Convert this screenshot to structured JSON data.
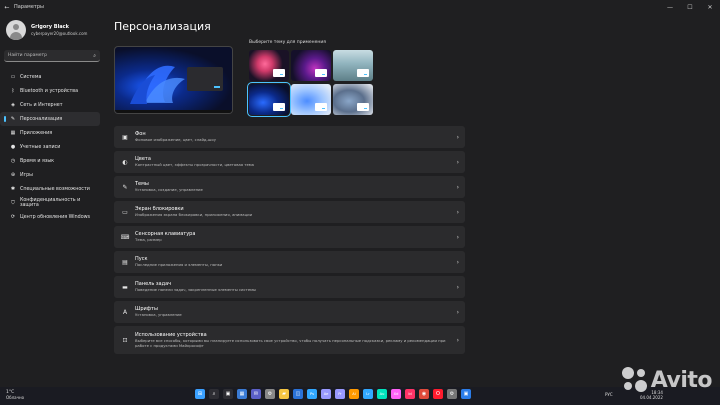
{
  "window": {
    "title": "Параметры",
    "back": "←",
    "controls": [
      "—",
      "☐",
      "✕"
    ]
  },
  "user": {
    "name": "Grigory Black",
    "email": "cyberpayer20@outlook.com"
  },
  "search": {
    "placeholder": "Найти параметр",
    "icon": "search-icon"
  },
  "nav": [
    {
      "label": "Система",
      "icon": "monitor-icon",
      "glyph": "▭"
    },
    {
      "label": "Bluetooth и устройства",
      "icon": "bluetooth-icon",
      "glyph": "ᛒ"
    },
    {
      "label": "Сеть и Интернет",
      "icon": "network-icon",
      "glyph": "◈"
    },
    {
      "label": "Персонализация",
      "icon": "brush-icon",
      "glyph": "✎",
      "active": true
    },
    {
      "label": "Приложения",
      "icon": "apps-icon",
      "glyph": "▦"
    },
    {
      "label": "Учетные записи",
      "icon": "person-icon",
      "glyph": "●"
    },
    {
      "label": "Время и язык",
      "icon": "globe-icon",
      "glyph": "◷"
    },
    {
      "label": "Игры",
      "icon": "gamepad-icon",
      "glyph": "⊕"
    },
    {
      "label": "Специальные возможности",
      "icon": "accessibility-icon",
      "glyph": "✱"
    },
    {
      "label": "Конфиденциальность и защита",
      "icon": "shield-icon",
      "glyph": "⛉"
    },
    {
      "label": "Центр обновления Windows",
      "icon": "update-icon",
      "glyph": "⟳"
    }
  ],
  "main": {
    "title": "Персонализация",
    "themes_label": "Выберите тему для применения"
  },
  "cards": [
    {
      "title": "Фон",
      "sub": "Фоновое изображение, цвет, слайд-шоу",
      "icon": "image-icon",
      "glyph": "▣"
    },
    {
      "title": "Цвета",
      "sub": "Контрастный цвет, эффекты прозрачности, цветовая тема",
      "icon": "palette-icon",
      "glyph": "◐"
    },
    {
      "title": "Темы",
      "sub": "Установка, создание, управление",
      "icon": "brush-icon",
      "glyph": "✎"
    },
    {
      "title": "Экран блокировки",
      "sub": "Изображения экрана блокировки, приложения, анимации",
      "icon": "lockscreen-icon",
      "glyph": "▭"
    },
    {
      "title": "Сенсорная клавиатура",
      "sub": "Тема, размер",
      "icon": "keyboard-icon",
      "glyph": "⌨"
    },
    {
      "title": "Пуск",
      "sub": "Последние приложения и элементы, папки",
      "icon": "start-icon",
      "glyph": "▤"
    },
    {
      "title": "Панель задач",
      "sub": "Поведение панели задач, закрепленные элементы системы",
      "icon": "taskbar-icon",
      "glyph": "▬"
    },
    {
      "title": "Шрифты",
      "sub": "Установка, управление",
      "icon": "font-icon",
      "glyph": "A"
    },
    {
      "title": "Использование устройства",
      "sub": "Выберите все способы, которыми вы планируете использовать свое устройство, чтобы получать персональные подсказки, рекламу и рекомендации при работе с продуктами Майкрософт",
      "icon": "device-usage-icon",
      "glyph": "⊡",
      "tall": true
    }
  ],
  "chevron": "›",
  "taskbar": {
    "weather_temp": "1°C",
    "weather_text": "Облачно",
    "lang": "РУС",
    "time": "18:34",
    "date": "04.04.2022",
    "icons": [
      "windows-start-icon",
      "search-icon",
      "taskview-icon",
      "widgets-icon",
      "chat-icon",
      "settings-icon",
      "explorer-icon",
      "store-icon",
      "photoshop-icon",
      "aftereffects-icon",
      "premiere-icon",
      "illustrator-icon",
      "lightroom-icon",
      "audition-icon",
      "xd-icon",
      "indesign-icon",
      "media-icon",
      "opera-icon",
      "gear-tray-icon",
      "app-icon"
    ]
  },
  "watermark": "Avito"
}
